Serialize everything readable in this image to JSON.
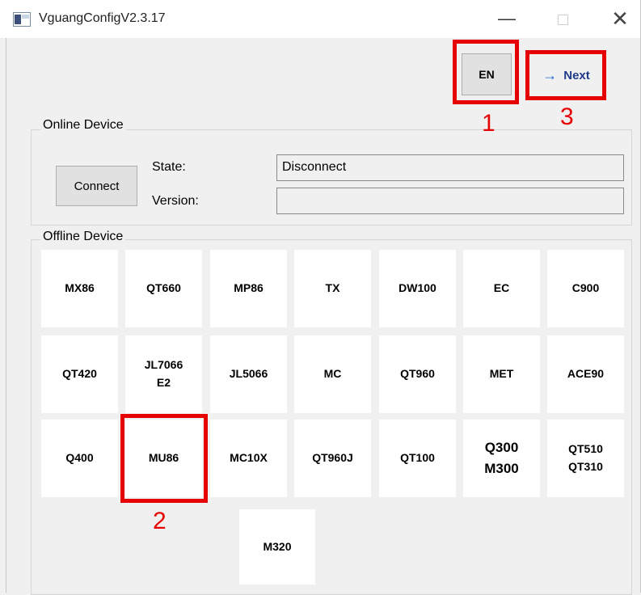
{
  "window": {
    "title": "VguangConfigV2.3.17",
    "minimize_glyph": "—",
    "close_glyph": "✕"
  },
  "toolbar": {
    "en_label": "EN",
    "next_arrow": "→",
    "next_label": "Next"
  },
  "online_device": {
    "title": "Online Device",
    "connect_label": "Connect",
    "state_label": "State:",
    "state_value": "Disconnect",
    "version_label": "Version:",
    "version_value": ""
  },
  "offline_device": {
    "title": "Offline Device",
    "devices": [
      [
        "MX86"
      ],
      [
        "QT660"
      ],
      [
        "MP86"
      ],
      [
        "TX"
      ],
      [
        "DW100"
      ],
      [
        "EC"
      ],
      [
        "C900"
      ],
      [
        "QT420"
      ],
      [
        "JL7066",
        "E2"
      ],
      [
        "JL5066"
      ],
      [
        "MC"
      ],
      [
        "QT960"
      ],
      [
        "MET"
      ],
      [
        "ACE90"
      ],
      [
        "Q400"
      ],
      [
        "MU86"
      ],
      [
        "MC10X"
      ],
      [
        "QT960J"
      ],
      [
        "QT100"
      ],
      [
        "Q300",
        "M300"
      ],
      [
        "QT510",
        "QT310"
      ],
      [
        "M320"
      ]
    ]
  },
  "annotations": {
    "one": "1",
    "two": "2",
    "three": "3"
  },
  "colors": {
    "annotation": "#e60000",
    "next_arrow": "#1e64d2",
    "window_bg": "#f0f0f0"
  }
}
